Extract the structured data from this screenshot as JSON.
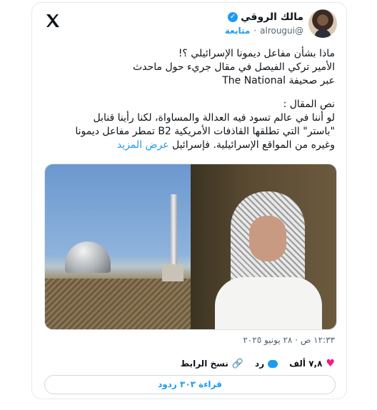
{
  "author": {
    "display_name": "مالك الروقي",
    "handle": "@alrougui",
    "follow_label": "متابعة",
    "separator": "·",
    "verified_mark": "✓"
  },
  "tweet": {
    "lines": [
      "ماذا بشأن مفاعل ديمونا الإسرائيلي ؟!",
      "الأمير تركي الفيصل في مقال جريء حول ماحدث",
      "عبر صحيفة The National",
      "نص المقال :",
      "لو أننا في عالم تسود فيه العدالة والمساواة، لكنا رأينا قنابل",
      "\"باستر\" التي تطلقها القاذفات الأمريكية B2 تمطر مفاعل ديمونا",
      "وغيره من المواقع الإسرائيلية. فإسرائيل"
    ],
    "show_more": "عرض المزيد"
  },
  "meta": {
    "time": "١٢:٣٣ ص",
    "date": "٢٨ يونيو ٢٠٢٥",
    "separator": "·"
  },
  "actions": {
    "likes": "٧,٨ ألف",
    "reply_label": "رد",
    "copy_link_label": "نسخ الرابط"
  },
  "read_replies": "قراءة ٣٠٣ ردود",
  "icons": {
    "logo": "x-logo-icon",
    "heart": "heart-icon",
    "reply": "reply-icon",
    "link": "link-icon",
    "verified": "verified-badge-icon"
  },
  "colors": {
    "accent": "#1d9bf0",
    "like": "#f91880",
    "text": "#0f1419",
    "muted": "#536471"
  }
}
